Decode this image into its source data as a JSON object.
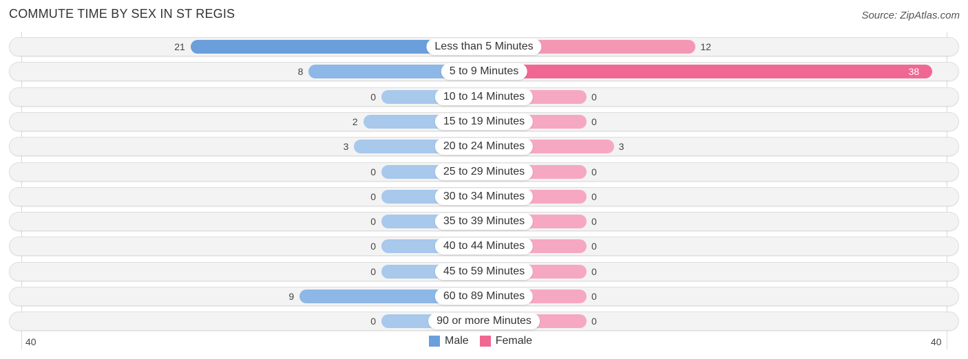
{
  "title": "COMMUTE TIME BY SEX IN ST REGIS",
  "source": "Source: ZipAtlas.com",
  "colors": {
    "male_strong": "#6a9fdb",
    "male_light": "#a8c8ec",
    "female_strong": "#f06892",
    "female_light": "#f6a8c2"
  },
  "chart_data": {
    "type": "bar",
    "orientation": "horizontal-diverging",
    "title": "COMMUTE TIME BY SEX IN ST REGIS",
    "categories": [
      "Less than 5 Minutes",
      "5 to 9 Minutes",
      "10 to 14 Minutes",
      "15 to 19 Minutes",
      "20 to 24 Minutes",
      "25 to 29 Minutes",
      "30 to 34 Minutes",
      "35 to 39 Minutes",
      "40 to 44 Minutes",
      "45 to 59 Minutes",
      "60 to 89 Minutes",
      "90 or more Minutes"
    ],
    "series": [
      {
        "name": "Male",
        "values": [
          21,
          8,
          0,
          2,
          3,
          0,
          0,
          0,
          0,
          0,
          9,
          0
        ]
      },
      {
        "name": "Female",
        "values": [
          12,
          38,
          0,
          0,
          3,
          0,
          0,
          0,
          0,
          0,
          0,
          0
        ]
      }
    ],
    "axis": {
      "left_label": "40",
      "right_label": "40",
      "range": [
        0,
        40
      ]
    },
    "legend": {
      "items": [
        "Male",
        "Female"
      ],
      "placement": "bottom-center"
    }
  }
}
